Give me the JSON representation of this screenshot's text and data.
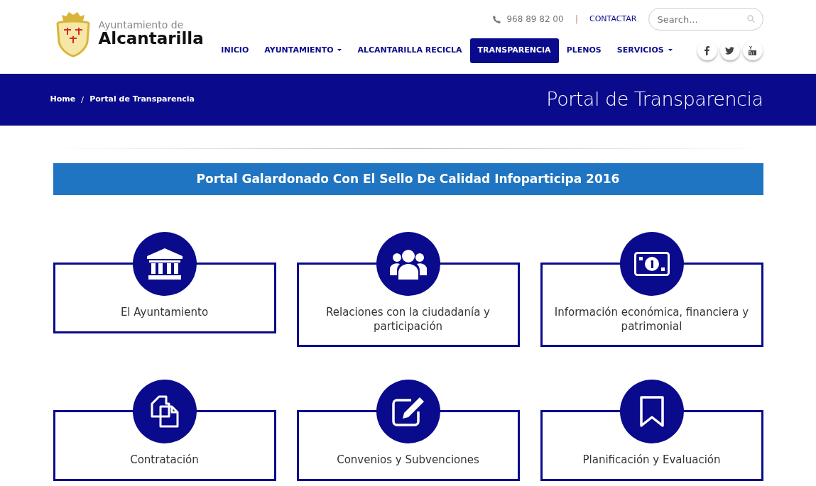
{
  "logo": {
    "subtitle": "Ayuntamiento de",
    "title": "Alcantarilla"
  },
  "topbar": {
    "phone": "968 89 82 00",
    "separator": "|",
    "contact": "CONTACTAR",
    "search": {
      "placeholder": "Search..."
    }
  },
  "nav": [
    {
      "label": "INICIO",
      "selected": false,
      "dropdown": false
    },
    {
      "label": "AYUNTAMIENTO",
      "selected": false,
      "dropdown": true
    },
    {
      "label": "ALCANTARILLA RECICLA",
      "selected": false,
      "dropdown": false
    },
    {
      "label": "TRANSPARENCIA",
      "selected": true,
      "dropdown": false
    },
    {
      "label": "PLENOS",
      "selected": false,
      "dropdown": false
    },
    {
      "label": "SERVICIOS",
      "selected": false,
      "dropdown": true
    }
  ],
  "social": [
    {
      "kind": "facebook"
    },
    {
      "kind": "twitter"
    },
    {
      "kind": "youtube"
    }
  ],
  "breadcrumb": [
    {
      "label": "Home"
    },
    {
      "label": "Portal de Transparencia"
    }
  ],
  "page_title": "Portal de Transparencia",
  "award_banner": "Portal Galardonado Con El Sello De Calidad Infoparticipa 2016",
  "cards": [
    {
      "kind": "building",
      "label": "El Ayuntamiento"
    },
    {
      "kind": "people",
      "label": "Relaciones con la ciudadanía y participación"
    },
    {
      "kind": "money",
      "label": "Información económica, financiera y patrimonial"
    },
    {
      "kind": "copy",
      "label": "Contratación"
    },
    {
      "kind": "edit",
      "label": "Convenios y Subvenciones"
    },
    {
      "kind": "bookmark",
      "label": "Planificación y Evaluación"
    }
  ]
}
